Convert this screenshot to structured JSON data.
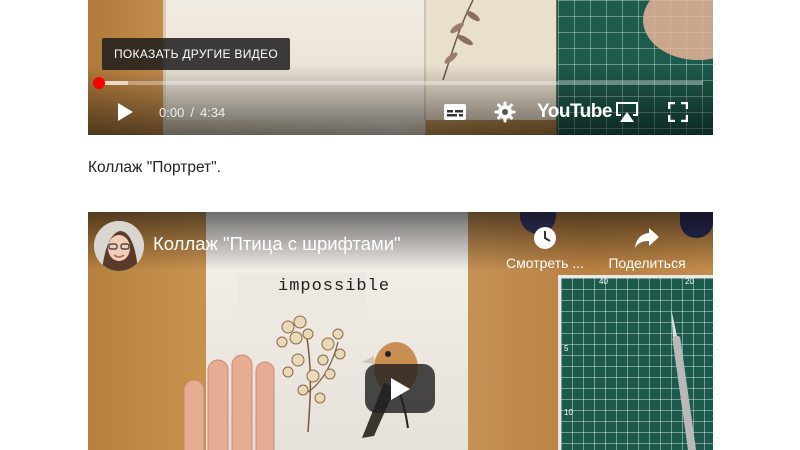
{
  "video1": {
    "more_videos_label": "ПОКАЗАТЬ ДРУГИЕ ВИДЕО",
    "time_current": "0:00",
    "time_separator": "/",
    "time_total": "4:34",
    "logo_text": "YouTube",
    "progress_fraction": 0.0,
    "icons": [
      "play-icon",
      "subtitles-icon",
      "settings-icon",
      "airplay-icon",
      "fullscreen-icon"
    ]
  },
  "caption": "Коллаж \"Портрет\".",
  "video2": {
    "title": "Коллаж \"Птица с шрифтами\"",
    "watch_later_label": "Смотреть ...",
    "share_label": "Поделиться",
    "scene_word": "impossible",
    "mat_numbers": [
      "40",
      "20",
      "5",
      "10"
    ],
    "icons": [
      "avatar",
      "clock-icon",
      "share-icon",
      "play-icon"
    ]
  },
  "colors": {
    "progress": "#ff0000",
    "mat": "#1c5b4c",
    "play_button_bg": "#212121"
  }
}
